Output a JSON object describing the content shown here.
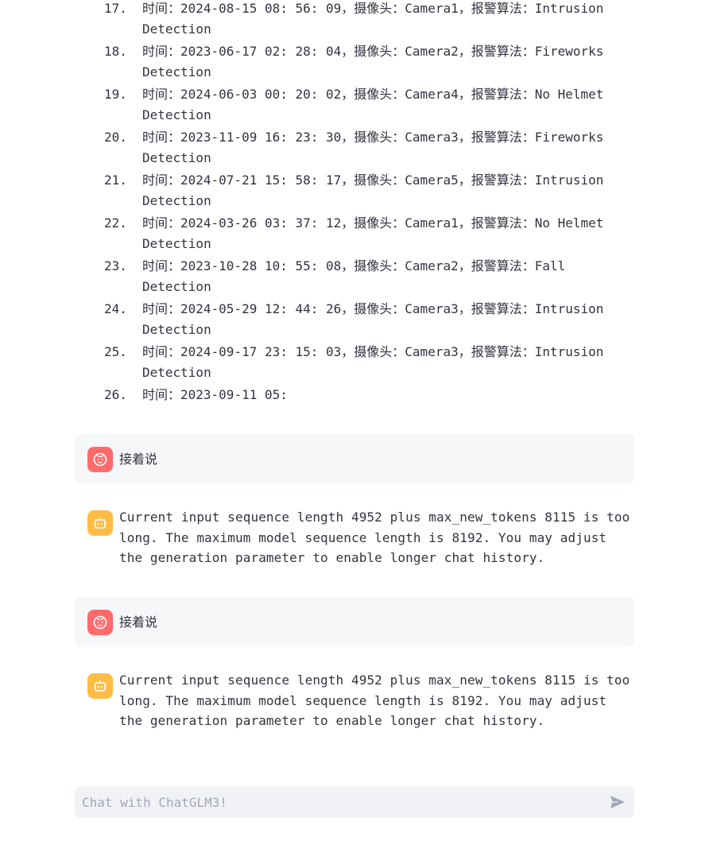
{
  "history_list": [
    {
      "num": "17.",
      "text": "时间：2024-08-15 08: 56: 09，摄像头：Camera1，报警算法：Intrusion Detection"
    },
    {
      "num": "18.",
      "text": "时间：2023-06-17 02: 28: 04，摄像头：Camera2，报警算法：Fireworks Detection"
    },
    {
      "num": "19.",
      "text": "时间：2024-06-03 00: 20: 02，摄像头：Camera4，报警算法：No Helmet Detection"
    },
    {
      "num": "20.",
      "text": "时间：2023-11-09 16: 23: 30，摄像头：Camera3，报警算法：Fireworks Detection"
    },
    {
      "num": "21.",
      "text": "时间：2024-07-21 15: 58: 17，摄像头：Camera5，报警算法：Intrusion Detection"
    },
    {
      "num": "22.",
      "text": "时间：2024-03-26 03: 37: 12，摄像头：Camera1，报警算法：No Helmet Detection"
    },
    {
      "num": "23.",
      "text": "时间：2023-10-28 10: 55: 08，摄像头：Camera2，报警算法：Fall Detection"
    },
    {
      "num": "24.",
      "text": "时间：2024-05-29 12: 44: 26，摄像头：Camera3，报警算法：Intrusion Detection"
    },
    {
      "num": "25.",
      "text": "时间：2024-09-17 23: 15: 03，摄像头：Camera3，报警算法：Intrusion Detection"
    },
    {
      "num": "26.",
      "text": "时间：2023-09-11 05:"
    }
  ],
  "messages": [
    {
      "role": "user",
      "text": "接着说"
    },
    {
      "role": "assistant",
      "text": "Current input sequence length 4952 plus max_new_tokens 8115 is too long. The maximum model sequence length is 8192. You may adjust the generation parameter to enable longer chat history."
    },
    {
      "role": "user",
      "text": "接着说"
    },
    {
      "role": "assistant",
      "text": "Current input sequence length 4952 plus max_new_tokens 8115 is too long. The maximum model sequence length is 8192. You may adjust the generation parameter to enable longer chat history."
    }
  ],
  "chat_input": {
    "placeholder": "Chat with ChatGLM3!",
    "value": ""
  },
  "icons": {
    "user_avatar": "user-face-icon",
    "bot_avatar": "robot-icon",
    "send": "send-icon"
  },
  "colors": {
    "user_avatar_bg": "#ff6b6b",
    "bot_avatar_bg": "#ffbd45",
    "user_message_bg": "#f6f7f9",
    "input_bg": "#f0f2f6"
  }
}
